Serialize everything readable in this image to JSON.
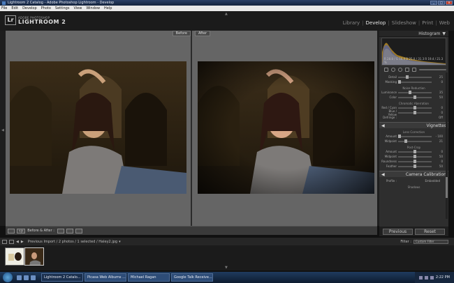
{
  "window": {
    "title": "Lightroom 2 Catalog - Adobe Photoshop Lightroom - Develop"
  },
  "menu": [
    "File",
    "Edit",
    "Develop",
    "Photo",
    "Settings",
    "View",
    "Window",
    "Help"
  ],
  "logo": {
    "badge": "Lr",
    "adobe": "ADOBE PHOTOSHOP",
    "name": "LIGHTROOM 2"
  },
  "modules": [
    {
      "label": "Library",
      "active": false
    },
    {
      "label": "Develop",
      "active": true
    },
    {
      "label": "Slideshow",
      "active": false
    },
    {
      "label": "Print",
      "active": false
    },
    {
      "label": "Web",
      "active": false
    }
  ],
  "view": {
    "before_label": "Before",
    "after_label": "After"
  },
  "toolbar": {
    "mode_label": "Before & After :"
  },
  "histogram": {
    "title": "Histogram",
    "readout": "R 28.8 / G 16.9  B 25.0 / 31.3  R 19.4 / 21.3 %"
  },
  "detail": {
    "rows": [
      {
        "label": "Detail",
        "value": "25",
        "pos": 0.25
      },
      {
        "label": "Masking",
        "value": "0",
        "pos": 0.0
      }
    ],
    "noise_title": "Noise Reduction",
    "noise": [
      {
        "label": "Luminance",
        "value": "35",
        "pos": 0.35
      },
      {
        "label": "Color",
        "value": "50",
        "pos": 0.5
      }
    ],
    "ca_title": "Chromatic Aberration",
    "ca": [
      {
        "label": "Red / Cyan",
        "value": "0",
        "pos": 0.5
      },
      {
        "label": "Blue / Yellow",
        "value": "0",
        "pos": 0.5
      }
    ],
    "defringe_label": "Defringe :",
    "defringe_value": "Off"
  },
  "vignettes": {
    "title": "Vignettes",
    "lens_title": "Lens Correction",
    "lens": [
      {
        "label": "Amount",
        "value": "- 100",
        "pos": 0.0
      },
      {
        "label": "Midpoint",
        "value": "21",
        "pos": 0.21
      }
    ],
    "post_title": "Post-Crop",
    "post": [
      {
        "label": "Amount",
        "value": "0",
        "pos": 0.5
      },
      {
        "label": "Midpoint",
        "value": "50",
        "pos": 0.5
      },
      {
        "label": "Roundness",
        "value": "0",
        "pos": 0.5
      },
      {
        "label": "Feather",
        "value": "50",
        "pos": 0.5
      }
    ]
  },
  "calibration": {
    "title": "Camera Calibration",
    "profile_label": "Profile :",
    "profile_value": "Embedded",
    "shadows_label": "Shadows"
  },
  "buttons": {
    "previous": "Previous",
    "reset": "Reset"
  },
  "filmstrip": {
    "info": "Previous Import / 2 photos / 1 selected / Haley2.jpg",
    "filter_label": "Filter :",
    "filter_value": "Custom Filter"
  },
  "taskbar": {
    "tasks": [
      {
        "label": "Lightroom 2 Catalo...",
        "active": true
      },
      {
        "label": "Picasa Web Albums ...",
        "active": false
      },
      {
        "label": "Michael Ragan",
        "active": false
      },
      {
        "label": "Google Talk Receive...",
        "active": false
      }
    ],
    "clock": "2:22 PM"
  }
}
